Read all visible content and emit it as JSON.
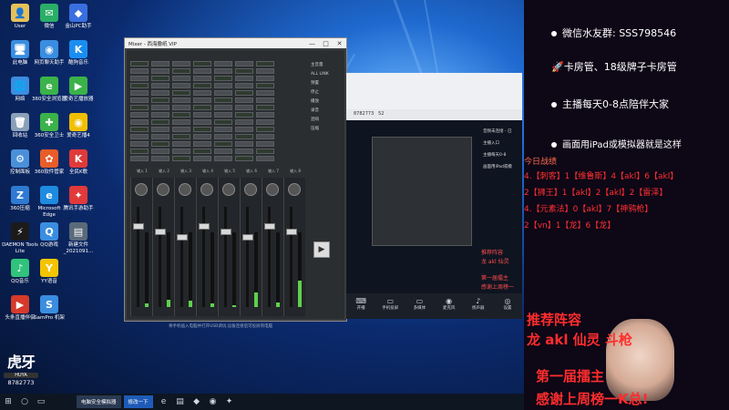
{
  "desktop": {
    "icons": [
      {
        "label": "User",
        "color": "#e6c15a",
        "glyph": "👤"
      },
      {
        "label": "此电脑",
        "color": "#3a8de0",
        "glyph": "🖥"
      },
      {
        "label": "网络",
        "color": "#3a8de0",
        "glyph": "🌐"
      },
      {
        "label": "回收站",
        "color": "#8aa0b8",
        "glyph": "🗑"
      },
      {
        "label": "控制面板",
        "color": "#4a90d9",
        "glyph": "⚙"
      },
      {
        "label": "360压缩",
        "color": "#2e7ad1",
        "glyph": "Z"
      },
      {
        "label": "DAEMON Tools Lite",
        "color": "#1b1b1b",
        "glyph": "⚡"
      },
      {
        "label": "QQ音乐",
        "color": "#31c27c",
        "glyph": "♪"
      },
      {
        "label": "头条直播伴侣",
        "color": "#d63a2a",
        "glyph": "▶"
      },
      {
        "label": "微信",
        "color": "#2aae67",
        "glyph": "✉"
      },
      {
        "label": "网页聊天助手",
        "color": "#3a8de0",
        "glyph": "◉"
      },
      {
        "label": "360安全浏览器",
        "color": "#3bb24a",
        "glyph": "e"
      },
      {
        "label": "360安全卫士",
        "color": "#3bb24a",
        "glyph": "✚"
      },
      {
        "label": "360软件管家",
        "color": "#e85d2a",
        "glyph": "✿"
      },
      {
        "label": "Microsoft Edge",
        "color": "#1e8be0",
        "glyph": "e"
      },
      {
        "label": "QQ游戏",
        "color": "#3a8de0",
        "glyph": "Q"
      },
      {
        "label": "YY语音",
        "color": "#f5c400",
        "glyph": "Y"
      },
      {
        "label": "SamPro 机架",
        "color": "#3a8de0",
        "glyph": "S"
      },
      {
        "label": "金山PC助手",
        "color": "#3a6fe0",
        "glyph": "◆"
      },
      {
        "label": "酷狗音乐",
        "color": "#1a8ef0",
        "glyph": "K"
      },
      {
        "label": "爱奇艺播放器",
        "color": "#3bb24a",
        "glyph": "▶"
      },
      {
        "label": "爱奇艺播4",
        "color": "#f0c000",
        "glyph": "◉"
      },
      {
        "label": "全民K歌",
        "color": "#e03a3a",
        "glyph": "K"
      },
      {
        "label": "腾讯手游助手",
        "color": "#e03a3a",
        "glyph": "✦"
      },
      {
        "label": "新建文件 _2021091...",
        "color": "#5a6a7a",
        "glyph": "▤"
      }
    ]
  },
  "mixer": {
    "title": "Mixer - 西海撒纸 VIP",
    "controls": [
      "—",
      "□",
      "✕"
    ],
    "channel_labels": [
      "输入 1",
      "输入 2",
      "输入 3",
      "输入 4",
      "输入 5",
      "输入 6",
      "输入 7",
      "输入 8"
    ],
    "channel_levels": [
      0.05,
      0.1,
      0.08,
      0.05,
      0.03,
      0.2,
      0.06,
      0.35
    ],
    "right_labels": [
      "主音量",
      "ALL LINK",
      "预置",
      "停止",
      "播放",
      "录音",
      "混响",
      "压缩"
    ],
    "play_glyph": "▶"
  },
  "preview": {
    "room_id": "8782773",
    "count": "52",
    "side_menu": [
      "音频未连接 - 已",
      "主播入口",
      "主播每天0-8",
      "画面用iPad或模"
    ],
    "toolbar": [
      {
        "icon": "⌨",
        "label": "开播"
      },
      {
        "icon": "▭",
        "label": "手机投屏"
      },
      {
        "icon": "▭",
        "label": "多媒体"
      },
      {
        "icon": "◉",
        "label": "麦克风"
      },
      {
        "icon": "♪",
        "label": "扬声器"
      },
      {
        "icon": "◎",
        "label": "设置"
      }
    ],
    "overlay": [
      "推荐阵容",
      "龙 akl 仙灵",
      "第一届擂主",
      "感谢上周榜一"
    ]
  },
  "right_panel": {
    "notices": [
      "微信水友群:  SSS798546",
      "🚀卡房管、18级牌子卡房管",
      "主播每天0-8点陪伴大家",
      "画面用iPad或模拟器就是这样"
    ],
    "record_title": "今日战绩",
    "record_lines": [
      "4.【刺客】1【维鲁斯】4【akl】6【akl】",
      "2【狮王】1【akl】2【akl】2【雷泽】",
      "4.【元素法】0【akl】7【神鸦枪】",
      "2【vn】1【龙】6【龙】"
    ],
    "lineup_title": "推荐阵容",
    "lineup": "龙 akl 仙灵 斗枪",
    "champion_title": "第一届擂主",
    "thanks": "感谢上周榜一K总!"
  },
  "taskbar": {
    "items": [
      "电脑安全模拟器",
      "修改一下"
    ],
    "status_text": "将手机插入电脑并打开USB调试,设备连接后可投屏到电脑"
  },
  "watermark": {
    "logo": "虎牙",
    "badge": "HUYA",
    "room_id": "8782773"
  }
}
